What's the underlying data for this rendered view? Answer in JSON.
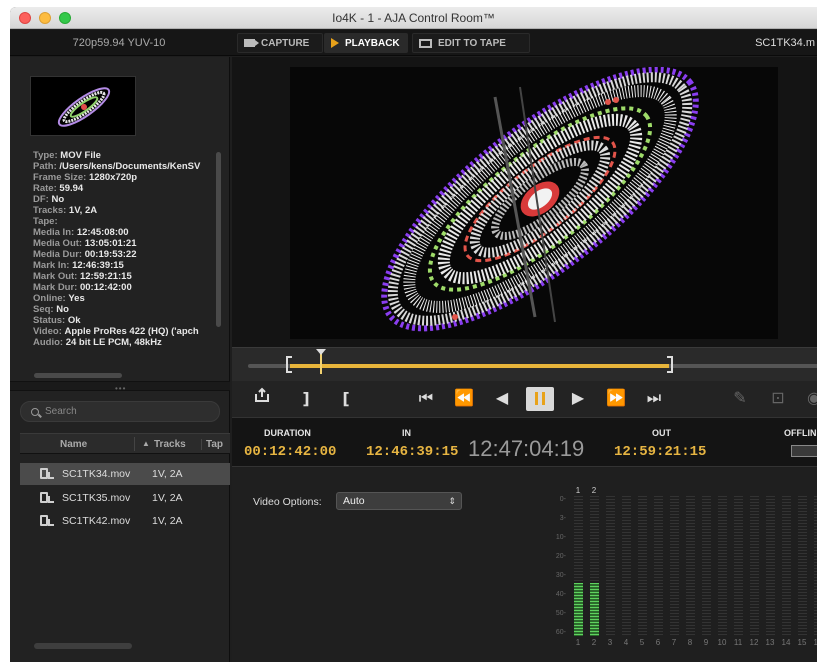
{
  "window": {
    "title": "Io4K - 1 - AJA Control Room™"
  },
  "topbar": {
    "format": "720p59.94  YUV-10",
    "tabs": [
      {
        "label": "CAPTURE"
      },
      {
        "label": "PLAYBACK"
      },
      {
        "label": "EDIT TO TAPE"
      }
    ],
    "clip_name": "SC1TK34.m"
  },
  "info": {
    "type": {
      "k": "Type:",
      "v": "MOV File"
    },
    "path": {
      "k": "Path:",
      "v": "/Users/kens/Documents/KenSV"
    },
    "frame_size": {
      "k": "Frame Size:",
      "v": "1280x720p"
    },
    "rate": {
      "k": "Rate:",
      "v": "59.94"
    },
    "df": {
      "k": "DF:",
      "v": "No"
    },
    "tracks": {
      "k": "Tracks:",
      "v": "1V, 2A"
    },
    "tape": {
      "k": "Tape:",
      "v": ""
    },
    "media_in": {
      "k": "Media In:",
      "v": "12:45:08:00"
    },
    "media_out": {
      "k": "Media Out:",
      "v": "13:05:01:21"
    },
    "media_dur": {
      "k": "Media Dur:",
      "v": "00:19:53:22"
    },
    "mark_in": {
      "k": "Mark In:",
      "v": "12:46:39:15"
    },
    "mark_out": {
      "k": "Mark Out:",
      "v": "12:59:21:15"
    },
    "mark_dur": {
      "k": "Mark Dur:",
      "v": "00:12:42:00"
    },
    "online": {
      "k": "Online:",
      "v": "Yes"
    },
    "seq": {
      "k": "Seq:",
      "v": "No"
    },
    "status": {
      "k": "Status:",
      "v": "Ok"
    },
    "video": {
      "k": "Video:",
      "v": "Apple ProRes 422 (HQ) ('apch"
    },
    "audio": {
      "k": "Audio:",
      "v": "24 bit LE PCM, 48kHz"
    }
  },
  "search": {
    "placeholder": "Search"
  },
  "table": {
    "headers": {
      "name": "Name",
      "tracks": "Tracks",
      "tape": "Tap"
    },
    "rows": [
      {
        "name": "SC1TK34.mov",
        "tracks": "1V, 2A"
      },
      {
        "name": "SC1TK35.mov",
        "tracks": "1V, 2A"
      },
      {
        "name": "SC1TK42.mov",
        "tracks": "1V, 2A"
      }
    ]
  },
  "timeline": {
    "in_position": 0.073,
    "playhead_position": 0.126,
    "out_position": 0.733
  },
  "timecode": {
    "duration_label": "DURATION",
    "duration": "00:12:42:00",
    "in_label": "IN",
    "in": "12:46:39:15",
    "current": "12:47:04:19",
    "out_label": "OUT",
    "out": "12:59:21:15",
    "offline_label": "OFFLINE"
  },
  "options": {
    "video_label": "Video Options:",
    "video_value": "Auto"
  },
  "audio_meter": {
    "channels": [
      "1",
      "2",
      "3",
      "4",
      "5",
      "6",
      "7",
      "8",
      "9",
      "10",
      "11",
      "12",
      "13",
      "14",
      "15",
      "16"
    ],
    "active_top": [
      "1",
      "2"
    ],
    "levels": [
      0.38,
      0.38,
      0,
      0,
      0,
      0,
      0,
      0,
      0,
      0,
      0,
      0,
      0,
      0,
      0,
      0
    ],
    "db_labels": [
      "0-",
      "3-",
      "10-",
      "20-",
      "30-",
      "40-",
      "50-",
      "60-"
    ]
  },
  "colors": {
    "accent": "#e8a21a",
    "timecode": "#e7b542",
    "meter_green": "#5fd35f"
  }
}
